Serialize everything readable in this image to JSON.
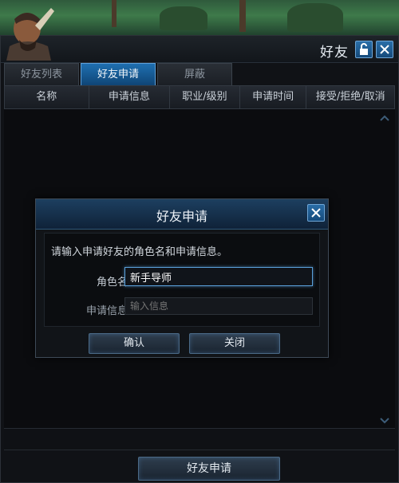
{
  "window": {
    "title": "好友",
    "lock_icon": "lock-open-icon",
    "close_icon": "close-icon"
  },
  "tabs": [
    {
      "label": "好友列表",
      "active": false
    },
    {
      "label": "好友申请",
      "active": true
    },
    {
      "label": "屏蔽",
      "active": false
    }
  ],
  "columns": [
    "名称",
    "申请信息",
    "职业/级别",
    "申请时间",
    "接受/拒绝/取消"
  ],
  "bottom_button": "好友申请",
  "dialog": {
    "title": "好友申请",
    "prompt": "请输入申请好友的角色名和申请信息。",
    "name_label": "角色名",
    "name_value": "新手导师",
    "info_label": "申请信息",
    "info_placeholder": "输入信息",
    "confirm_label": "确认",
    "close_label": "关闭"
  },
  "colors": {
    "accent": "#1f6fb0",
    "background": "#101216",
    "input_focus": "#5aa1dc"
  }
}
